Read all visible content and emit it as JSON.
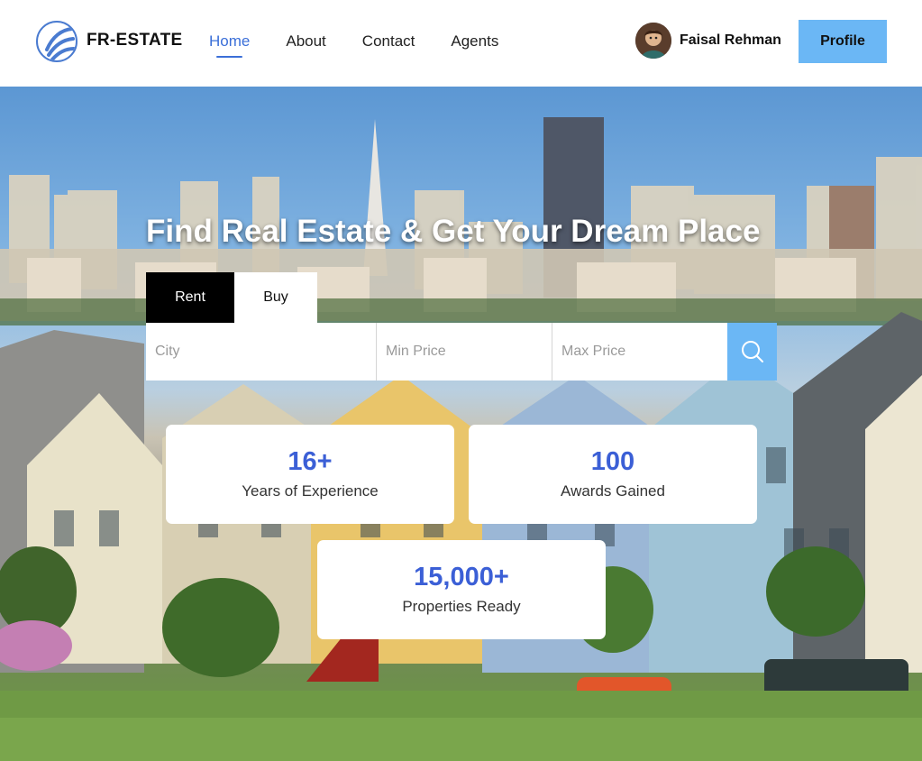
{
  "header": {
    "brand": "FR-ESTATE",
    "nav": [
      {
        "label": "Home",
        "active": true
      },
      {
        "label": "About",
        "active": false
      },
      {
        "label": "Contact",
        "active": false
      },
      {
        "label": "Agents",
        "active": false
      }
    ],
    "user_name": "Faisal Rehman",
    "profile_label": "Profile"
  },
  "hero": {
    "title": "Find Real Estate & Get Your Dream Place",
    "tabs": {
      "rent": "Rent",
      "buy": "Buy",
      "selected": "Rent"
    },
    "search": {
      "city_placeholder": "City",
      "min_price_placeholder": "Min Price",
      "max_price_placeholder": "Max Price",
      "button_icon": "search-icon"
    }
  },
  "stats": [
    {
      "value": "16+",
      "label": "Years of Experience"
    },
    {
      "value": "100",
      "label": "Awards Gained"
    },
    {
      "value": "15,000+",
      "label": "Properties Ready"
    }
  ],
  "colors": {
    "accent_blue": "#6bb7f5",
    "stat_value": "#3b5fd6",
    "nav_active": "#3b6fd8"
  }
}
